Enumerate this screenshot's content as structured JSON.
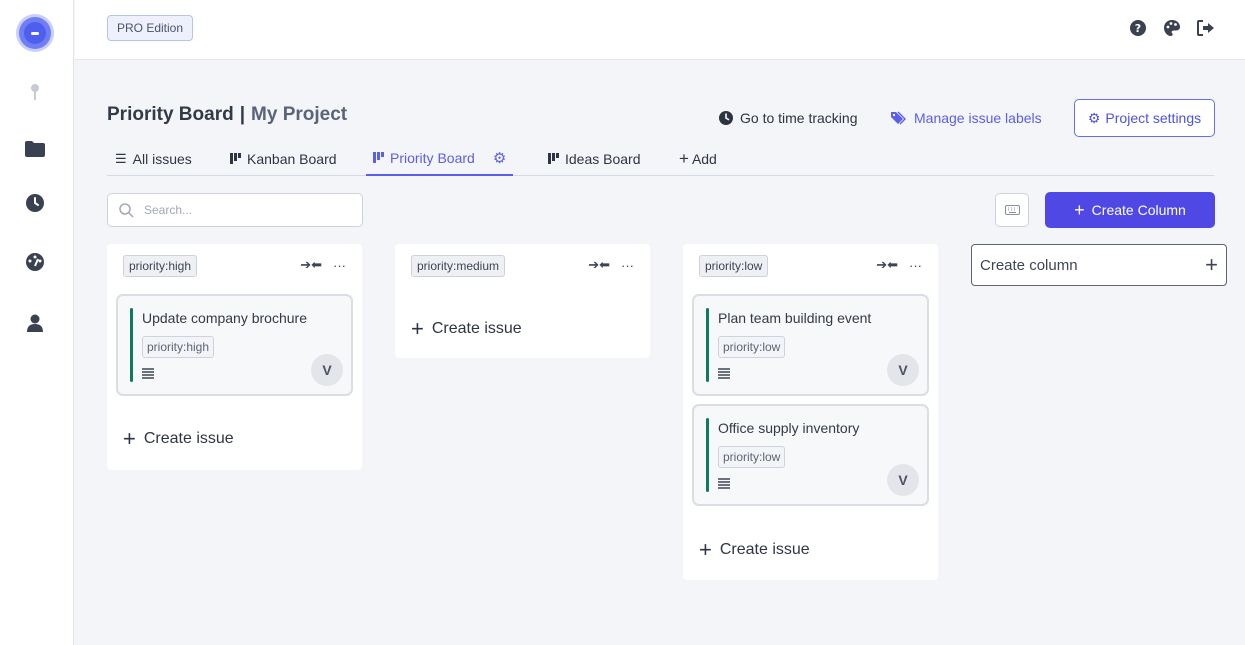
{
  "topbar": {
    "edition_badge": "PRO Edition",
    "icons": [
      "help-icon",
      "palette-icon",
      "logout-icon"
    ]
  },
  "sidebar": {
    "items": [
      {
        "icon": "pin-icon"
      },
      {
        "icon": "folder-icon"
      },
      {
        "icon": "clock-icon"
      },
      {
        "icon": "dashboard-icon"
      },
      {
        "icon": "user-icon"
      }
    ]
  },
  "header": {
    "board_title": "Priority Board",
    "separator": "|",
    "project_name": "My Project",
    "time_tracking_label": "Go to time tracking",
    "manage_labels_label": "Manage issue labels",
    "project_settings_label": "Project settings"
  },
  "tabs": [
    {
      "label": "All issues",
      "icon": "list-icon"
    },
    {
      "label": "Kanban Board",
      "icon": "board-icon"
    },
    {
      "label": "Priority Board",
      "icon": "board-icon",
      "active": true
    },
    {
      "label": "Ideas Board",
      "icon": "board-icon"
    },
    {
      "label": "Add",
      "icon": "plus-icon"
    }
  ],
  "toolbar": {
    "search_placeholder": "Search...",
    "create_column_label": "Create Column"
  },
  "columns": [
    {
      "label": "priority:high",
      "cards": [
        {
          "title": "Update company brochure",
          "label": "priority:high",
          "avatar": "V"
        }
      ],
      "create_issue_label": "Create issue"
    },
    {
      "label": "priority:medium",
      "cards": [],
      "create_issue_label": "Create issue"
    },
    {
      "label": "priority:low",
      "cards": [
        {
          "title": "Plan team building event",
          "label": "priority:low",
          "avatar": "V"
        },
        {
          "title": "Office supply inventory",
          "label": "priority:low",
          "avatar": "V"
        }
      ],
      "create_issue_label": "Create issue"
    }
  ],
  "new_column": {
    "label": "Create column"
  },
  "colors": {
    "accent": "#5048e5",
    "link": "#5b5ee6",
    "card_bar": "#0f7a5c"
  }
}
